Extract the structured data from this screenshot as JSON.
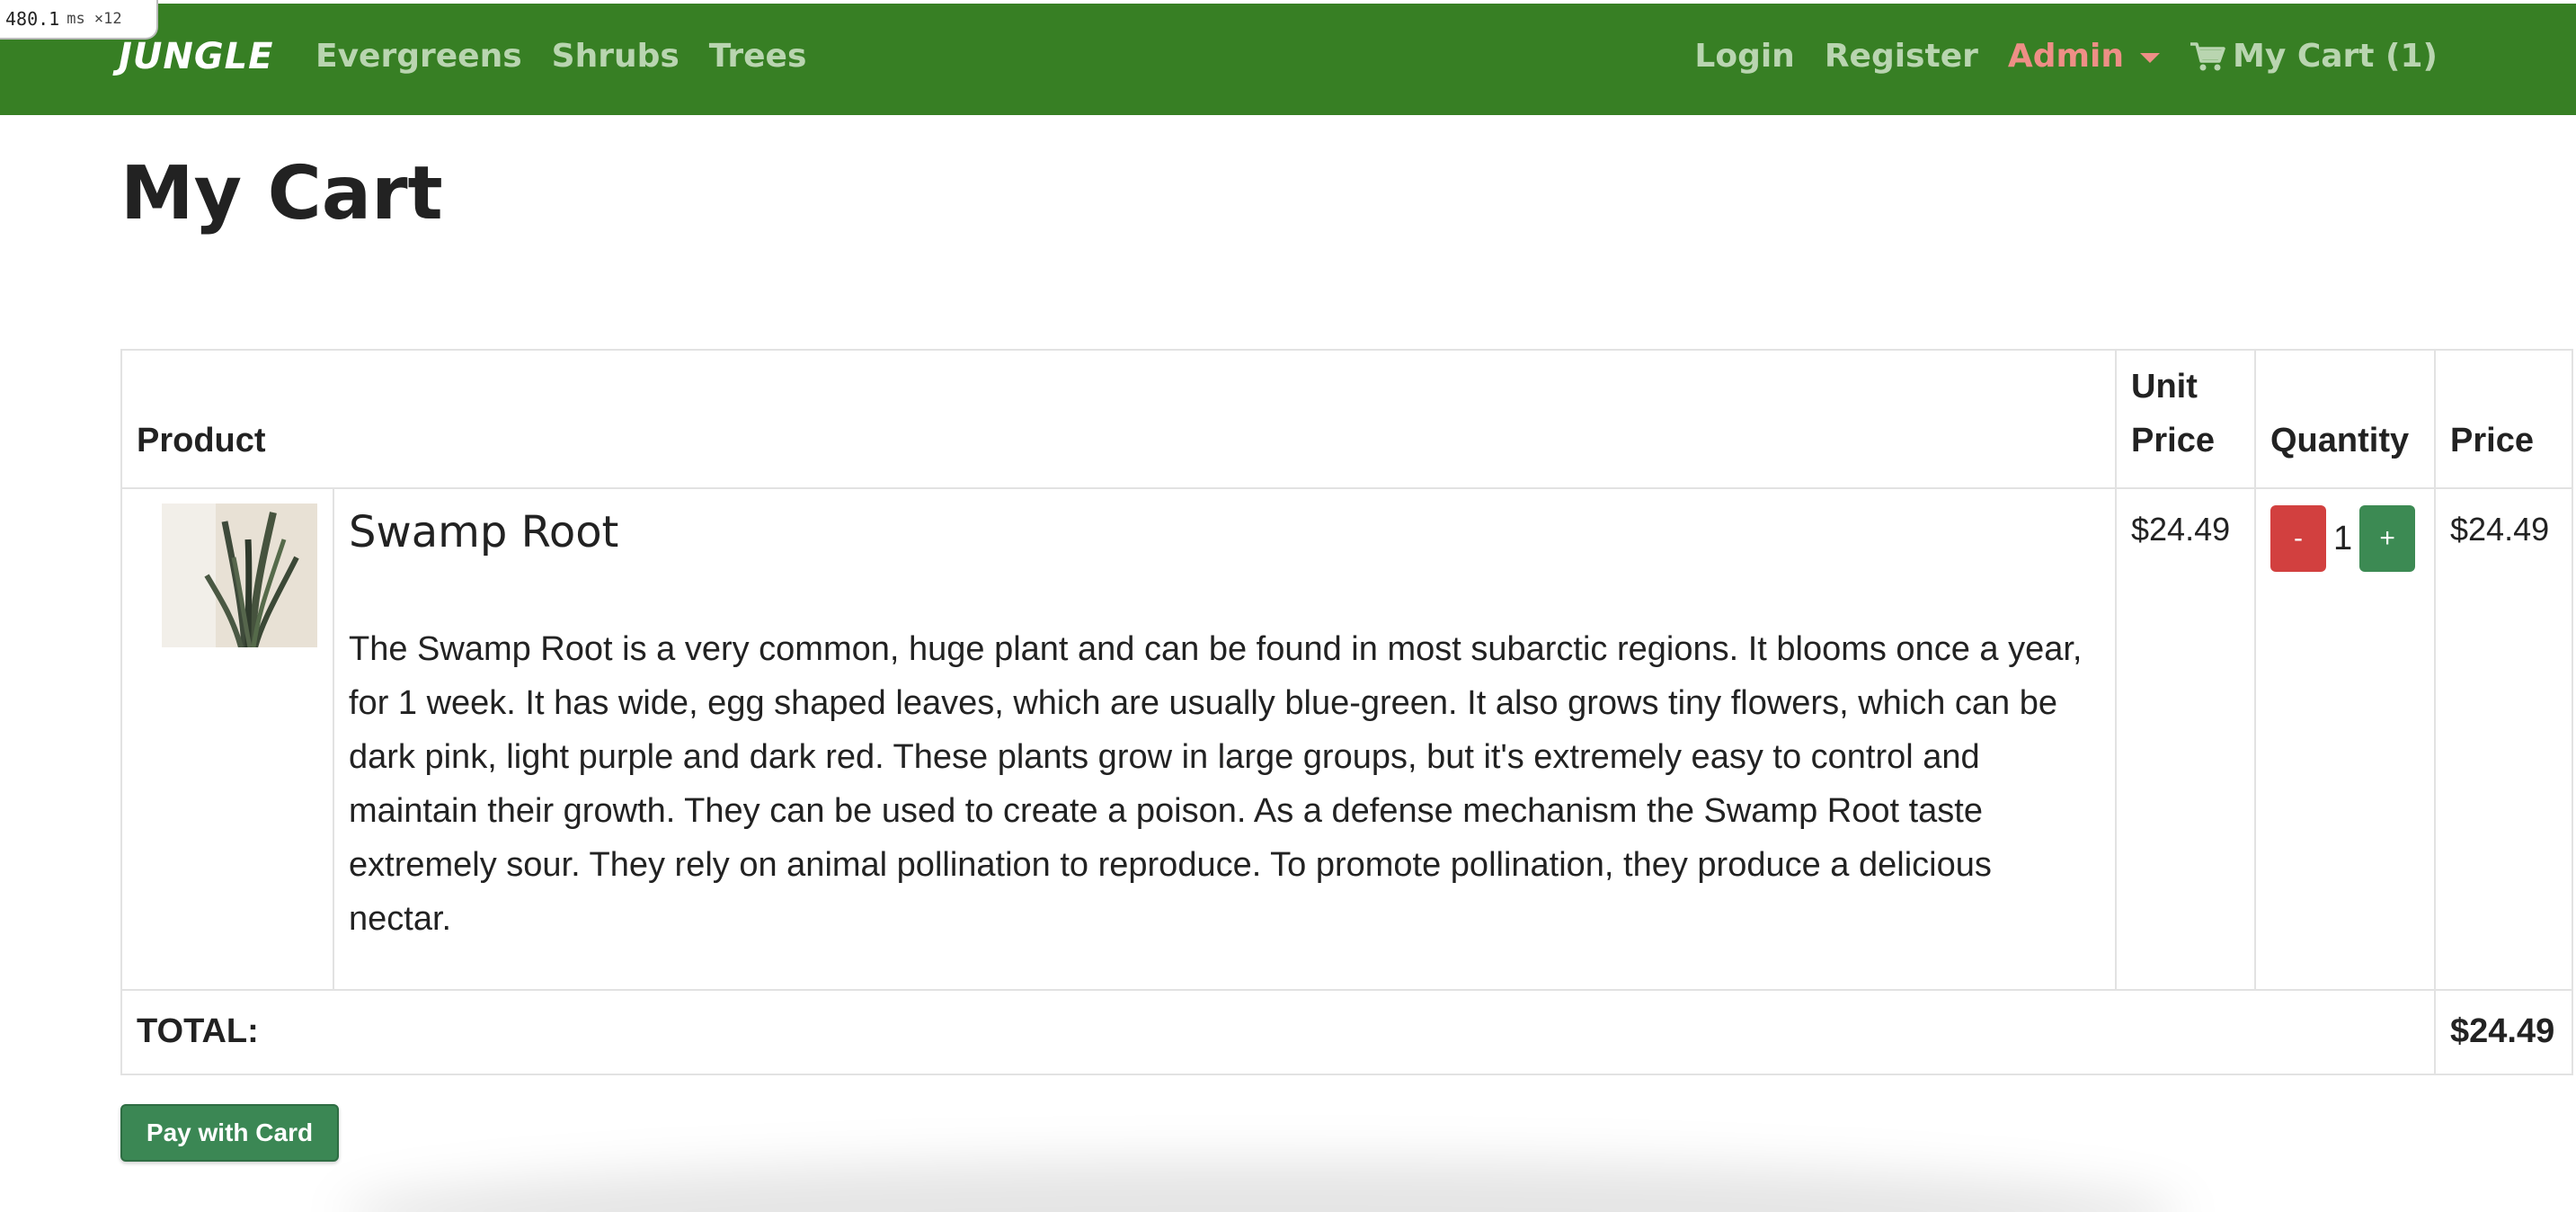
{
  "perf": {
    "value": "480.1",
    "unit": "ms ×12"
  },
  "nav": {
    "brand": "JUNGLE",
    "left_links": [
      "Evergreens",
      "Shrubs",
      "Trees"
    ],
    "login": "Login",
    "register": "Register",
    "admin": "Admin",
    "cart": "My Cart (1)",
    "cart_icon": "shopping-cart-icon"
  },
  "page": {
    "title": "My Cart"
  },
  "table": {
    "headers": {
      "product": "Product",
      "unit_price": "Unit Price",
      "quantity": "Quantity",
      "price": "Price"
    },
    "items": [
      {
        "name": "Swamp Root",
        "description": "The Swamp Root is a very common, huge plant and can be found in most subarctic regions. It blooms once a year, for 1 week. It has wide, egg shaped leaves, which are usually blue-green. It also grows tiny flowers, which can be dark pink, light purple and dark red. These plants grow in large groups, but it's extremely easy to control and maintain their growth. They can be used to create a poison. As a defense mechanism the Swamp Root taste extremely sour. They rely on animal pollination to reproduce. To promote pollination, they produce a delicious nectar.",
        "unit_price": "$24.49",
        "quantity": "1",
        "minus_label": "-",
        "plus_label": "+",
        "price": "$24.49"
      }
    ],
    "total_label": "TOTAL:",
    "total_value": "$24.49"
  },
  "actions": {
    "pay_label": "Pay with Card"
  },
  "colors": {
    "navbar": "#377f24",
    "nav_link": "#b9d5b0",
    "admin": "#ee8f86",
    "minus": "#d2403f",
    "plus": "#3c8a53",
    "pay": "#3b8754"
  }
}
